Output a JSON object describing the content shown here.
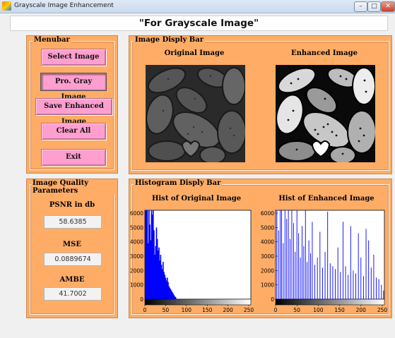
{
  "window": {
    "title": "Grayscale Image Enhancement"
  },
  "header": {
    "title": "\"For Grayscale Image\""
  },
  "menubar": {
    "title": "Menubar",
    "buttons": [
      "Select Image",
      "Pro. Gray Image",
      "Save Enhanced Image",
      "Clear All",
      "Exit"
    ]
  },
  "image_bar": {
    "title": "Image Disply Bar",
    "original_label": "Original Image",
    "enhanced_label": "Enhanced Image"
  },
  "quality": {
    "title": "Image Quality Parameters",
    "psnr_label": "PSNR in db",
    "psnr_value": "58.6385",
    "mse_label": "MSE",
    "mse_value": "0.0889674",
    "ambe_label": "AMBE",
    "ambe_value": "41.7002"
  },
  "histogram_bar": {
    "title": "Histogram Disply Bar",
    "original_hist_title": "Hist of Original Image",
    "enhanced_hist_title": "Hist of Enhanced Image"
  },
  "chart_data": [
    {
      "type": "bar",
      "title": "Hist of Original Image",
      "xlim": [
        0,
        255
      ],
      "ylim": [
        0,
        6200
      ],
      "x_ticks": [
        0,
        50,
        100,
        150,
        200,
        250
      ],
      "y_ticks": [
        0,
        1000,
        2000,
        3000,
        4000,
        5000,
        6000
      ],
      "series": [
        {
          "x": [
            2,
            4,
            6,
            8,
            10,
            12,
            14,
            16,
            18,
            20,
            22,
            24,
            26,
            28,
            30,
            32,
            34,
            36,
            38,
            40,
            42,
            44,
            46,
            48,
            50,
            52,
            54,
            56,
            58,
            60,
            62,
            64,
            66,
            68,
            70,
            72,
            74
          ],
          "values": [
            6200,
            6200,
            6200,
            3900,
            6200,
            5200,
            4100,
            6200,
            5900,
            6200,
            4800,
            3100,
            3700,
            5000,
            4200,
            3400,
            3600,
            2700,
            3100,
            2400,
            2100,
            2600,
            1900,
            1700,
            1500,
            1300,
            1500,
            1200,
            900,
            800,
            700,
            600,
            500,
            400,
            300,
            200,
            150
          ]
        }
      ],
      "color": "#0000ff"
    },
    {
      "type": "bar",
      "title": "Hist of Enhanced Image",
      "xlim": [
        0,
        255
      ],
      "ylim": [
        0,
        6200
      ],
      "x_ticks": [
        0,
        50,
        100,
        150,
        200,
        250
      ],
      "y_ticks": [
        0,
        1000,
        2000,
        3000,
        4000,
        5000,
        6000
      ],
      "series": [
        {
          "x": [
            3,
            7,
            11,
            14,
            18,
            22,
            26,
            30,
            34,
            38,
            42,
            46,
            50,
            54,
            58,
            62,
            66,
            70,
            74,
            78,
            82,
            86,
            92,
            98,
            104,
            110,
            116,
            122,
            128,
            134,
            140,
            146,
            152,
            158,
            164,
            170,
            176,
            182,
            188,
            194,
            200,
            206,
            212,
            218,
            224,
            230,
            236,
            242,
            248,
            253
          ],
          "values": [
            6200,
            4800,
            6200,
            6200,
            3900,
            6200,
            5600,
            6200,
            4200,
            6200,
            5300,
            3300,
            6200,
            4600,
            2900,
            5100,
            3700,
            6200,
            2600,
            4100,
            3200,
            5400,
            2400,
            2900,
            4700,
            2200,
            3300,
            6100,
            2500,
            2300,
            2100,
            3600,
            1900,
            5400,
            2300,
            1700,
            5100,
            2000,
            1800,
            4600,
            2900,
            1600,
            4900,
            4100,
            2200,
            3100,
            1500,
            1400,
            1000,
            600
          ]
        }
      ],
      "color": "#0000ff"
    }
  ]
}
